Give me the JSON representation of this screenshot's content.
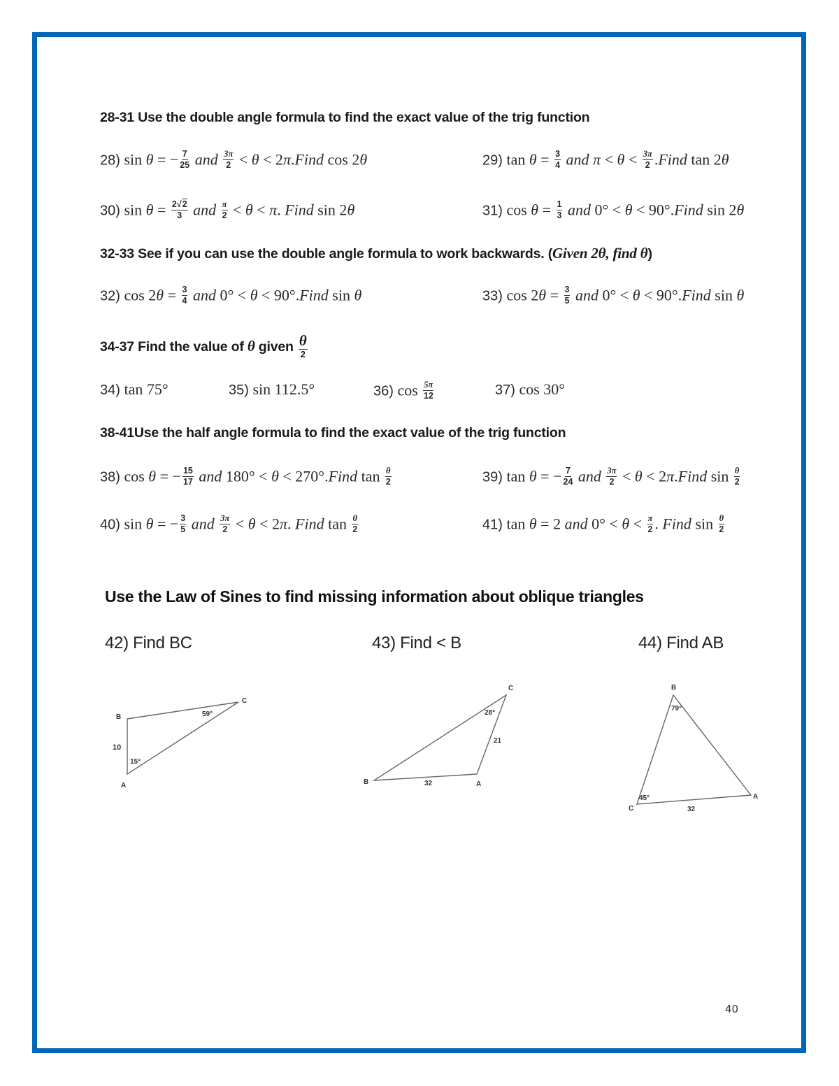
{
  "page": {
    "border_color": "#0067b8",
    "page_number": "40"
  },
  "sections": {
    "double_angle": {
      "heading": "28-31 Use the double angle formula to find the exact value of the trig function",
      "problems": [
        {
          "id": "28",
          "segments": [
            {
              "t": "text",
              "v": "sin "
            },
            {
              "t": "it",
              "v": "θ"
            },
            {
              "t": "text",
              "v": " = −"
            },
            {
              "t": "frac",
              "n": "7",
              "d": "25"
            },
            {
              "t": "it",
              "v": " and "
            },
            {
              "t": "frac",
              "n": "3π",
              "d": "2",
              "ni": true
            },
            {
              "t": "text",
              "v": " < "
            },
            {
              "t": "it",
              "v": "θ"
            },
            {
              "t": "text",
              "v": " < 2"
            },
            {
              "t": "it",
              "v": "π"
            },
            {
              "t": "text",
              "v": "."
            },
            {
              "t": "it",
              "v": "Find"
            },
            {
              "t": "text",
              "v": " cos 2"
            },
            {
              "t": "it",
              "v": "θ"
            }
          ]
        },
        {
          "id": "29",
          "segments": [
            {
              "t": "text",
              "v": "tan "
            },
            {
              "t": "it",
              "v": "θ"
            },
            {
              "t": "text",
              "v": " = "
            },
            {
              "t": "frac",
              "n": "3",
              "d": "4"
            },
            {
              "t": "it",
              "v": " and π"
            },
            {
              "t": "text",
              "v": " < "
            },
            {
              "t": "it",
              "v": "θ"
            },
            {
              "t": "text",
              "v": " < "
            },
            {
              "t": "frac",
              "n": "3π",
              "d": "2",
              "ni": true
            },
            {
              "t": "text",
              "v": "."
            },
            {
              "t": "it",
              "v": "Find"
            },
            {
              "t": "text",
              "v": " tan 2"
            },
            {
              "t": "it",
              "v": "θ"
            }
          ]
        },
        {
          "id": "30",
          "segments": [
            {
              "t": "text",
              "v": "sin "
            },
            {
              "t": "it",
              "v": "θ"
            },
            {
              "t": "text",
              "v": " = "
            },
            {
              "t": "frac",
              "n": "2",
              "sqrt": "2",
              "d": "3"
            },
            {
              "t": "it",
              "v": " and "
            },
            {
              "t": "frac",
              "n": "π",
              "d": "2",
              "ni": true
            },
            {
              "t": "text",
              "v": " < "
            },
            {
              "t": "it",
              "v": "θ"
            },
            {
              "t": "text",
              "v": " < "
            },
            {
              "t": "it",
              "v": "π"
            },
            {
              "t": "text",
              "v": ". "
            },
            {
              "t": "it",
              "v": "Find"
            },
            {
              "t": "text",
              "v": " sin 2"
            },
            {
              "t": "it",
              "v": "θ"
            }
          ]
        },
        {
          "id": "31",
          "segments": [
            {
              "t": "text",
              "v": " cos "
            },
            {
              "t": "it",
              "v": "θ"
            },
            {
              "t": "text",
              "v": " = "
            },
            {
              "t": "frac",
              "n": "1",
              "d": "3"
            },
            {
              "t": "it",
              "v": " and "
            },
            {
              "t": "text",
              "v": "0° < "
            },
            {
              "t": "it",
              "v": "θ"
            },
            {
              "t": "text",
              "v": " < 90°."
            },
            {
              "t": "it",
              "v": "Find"
            },
            {
              "t": "text",
              "v": " sin 2"
            },
            {
              "t": "it",
              "v": "θ"
            }
          ]
        }
      ]
    },
    "backwards": {
      "heading": "32-33 See if you can use the double angle formula to work backwards. (",
      "heading_italic": "Given 2θ, find θ",
      "heading_end": ")",
      "problems": [
        {
          "id": "32",
          "segments": [
            {
              "t": "text",
              "v": "cos 2"
            },
            {
              "t": "it",
              "v": "θ"
            },
            {
              "t": "text",
              "v": " = "
            },
            {
              "t": "frac",
              "n": "3",
              "d": "4"
            },
            {
              "t": "it",
              "v": " and "
            },
            {
              "t": "text",
              "v": "0° < "
            },
            {
              "t": "it",
              "v": "θ"
            },
            {
              "t": "text",
              "v": " < 90°."
            },
            {
              "t": "it",
              "v": "Find"
            },
            {
              "t": "text",
              "v": " sin "
            },
            {
              "t": "it",
              "v": "θ"
            }
          ]
        },
        {
          "id": "33",
          "segments": [
            {
              "t": "text",
              "v": "cos 2"
            },
            {
              "t": "it",
              "v": "θ"
            },
            {
              "t": "text",
              "v": " = "
            },
            {
              "t": "frac",
              "n": "3",
              "d": "5"
            },
            {
              "t": "it",
              "v": " and "
            },
            {
              "t": "text",
              "v": "0° < "
            },
            {
              "t": "it",
              "v": "θ"
            },
            {
              "t": "text",
              "v": " < 90°."
            },
            {
              "t": "it",
              "v": "Find"
            },
            {
              "t": "text",
              "v": " sin "
            },
            {
              "t": "it",
              "v": "θ"
            }
          ]
        }
      ]
    },
    "half_given": {
      "heading": "34-37 Find the value of ",
      "heading_theta": "θ",
      "heading_mid": " given ",
      "heading_frac": {
        "n": "θ",
        "d": "2"
      },
      "problems": [
        {
          "id": "34",
          "segments": [
            {
              "t": "text",
              "v": "tan 75°"
            }
          ]
        },
        {
          "id": "35",
          "segments": [
            {
              "t": "text",
              "v": "sin 112.5°"
            }
          ]
        },
        {
          "id": "36",
          "segments": [
            {
              "t": "text",
              "v": "cos "
            },
            {
              "t": "frac",
              "n": "5π",
              "d": "12",
              "ni": true
            }
          ]
        },
        {
          "id": "37",
          "segments": [
            {
              "t": "text",
              "v": "cos 30°"
            }
          ]
        }
      ]
    },
    "half_angle": {
      "heading": "38-41Use the half angle formula to find the exact value of the trig function",
      "problems": [
        {
          "id": "38",
          "segments": [
            {
              "t": "text",
              "v": "cos "
            },
            {
              "t": "it",
              "v": "θ"
            },
            {
              "t": "text",
              "v": " = −"
            },
            {
              "t": "frac",
              "n": "15",
              "d": "17"
            },
            {
              "t": "it",
              "v": " and "
            },
            {
              "t": "text",
              "v": "180° < "
            },
            {
              "t": "it",
              "v": "θ"
            },
            {
              "t": "text",
              "v": " < 270°."
            },
            {
              "t": "it",
              "v": "Find"
            },
            {
              "t": "text",
              "v": " tan "
            },
            {
              "t": "frac",
              "n": "θ",
              "d": "2",
              "ni": true
            }
          ]
        },
        {
          "id": "39",
          "segments": [
            {
              "t": "text",
              "v": "tan "
            },
            {
              "t": "it",
              "v": "θ"
            },
            {
              "t": "text",
              "v": " = −"
            },
            {
              "t": "frac",
              "n": "7",
              "d": "24"
            },
            {
              "t": "it",
              "v": " and "
            },
            {
              "t": "frac",
              "n": "3π",
              "d": "2",
              "ni": true
            },
            {
              "t": "text",
              "v": " < "
            },
            {
              "t": "it",
              "v": "θ"
            },
            {
              "t": "text",
              "v": " < 2"
            },
            {
              "t": "it",
              "v": "π"
            },
            {
              "t": "text",
              "v": "."
            },
            {
              "t": "it",
              "v": "Find"
            },
            {
              "t": "text",
              "v": " sin "
            },
            {
              "t": "frac",
              "n": "θ",
              "d": "2",
              "ni": true
            }
          ]
        },
        {
          "id": "40",
          "segments": [
            {
              "t": "text",
              "v": "sin "
            },
            {
              "t": "it",
              "v": "θ"
            },
            {
              "t": "text",
              "v": " = −"
            },
            {
              "t": "frac",
              "n": "3",
              "d": "5"
            },
            {
              "t": "it",
              "v": " and "
            },
            {
              "t": "frac",
              "n": "3π",
              "d": "2",
              "ni": true
            },
            {
              "t": "text",
              "v": " < "
            },
            {
              "t": "it",
              "v": "θ"
            },
            {
              "t": "text",
              "v": " < 2"
            },
            {
              "t": "it",
              "v": "π"
            },
            {
              "t": "text",
              "v": ".  "
            },
            {
              "t": "it",
              "v": "Find"
            },
            {
              "t": "text",
              "v": " tan "
            },
            {
              "t": "frac",
              "n": "θ",
              "d": "2",
              "ni": true
            }
          ]
        },
        {
          "id": "41",
          "segments": [
            {
              "t": "text",
              "v": "tan "
            },
            {
              "t": "it",
              "v": "θ"
            },
            {
              "t": "text",
              "v": " = 2 "
            },
            {
              "t": "it",
              "v": "and "
            },
            {
              "t": "text",
              "v": "0° < "
            },
            {
              "t": "it",
              "v": "θ"
            },
            {
              "t": "text",
              "v": " < "
            },
            {
              "t": "frac",
              "n": "π",
              "d": "2",
              "ni": true
            },
            {
              "t": "text",
              "v": ". "
            },
            {
              "t": "it",
              "v": "Find"
            },
            {
              "t": "text",
              "v": " sin "
            },
            {
              "t": "frac",
              "n": "θ",
              "d": "2",
              "ni": true
            }
          ]
        }
      ]
    },
    "law_of_sines": {
      "heading": "Use the Law of Sines to find missing information about oblique triangles",
      "problems": [
        {
          "id": "42",
          "prompt": "42) Find BC",
          "triangle": {
            "vertices": [
              "A",
              "B",
              "C"
            ],
            "side_labels": [
              "10"
            ],
            "angle_labels": [
              "15°",
              "59°"
            ]
          }
        },
        {
          "id": "43",
          "prompt": "43) Find < B",
          "triangle": {
            "vertices": [
              "A",
              "B",
              "C"
            ],
            "side_labels": [
              "32",
              "21"
            ],
            "angle_labels": [
              "28°"
            ]
          }
        },
        {
          "id": "44",
          "prompt": "44) Find AB",
          "triangle": {
            "vertices": [
              "A",
              "B",
              "C"
            ],
            "side_labels": [
              "32"
            ],
            "angle_labels": [
              "79°",
              "45°"
            ]
          }
        }
      ]
    }
  }
}
